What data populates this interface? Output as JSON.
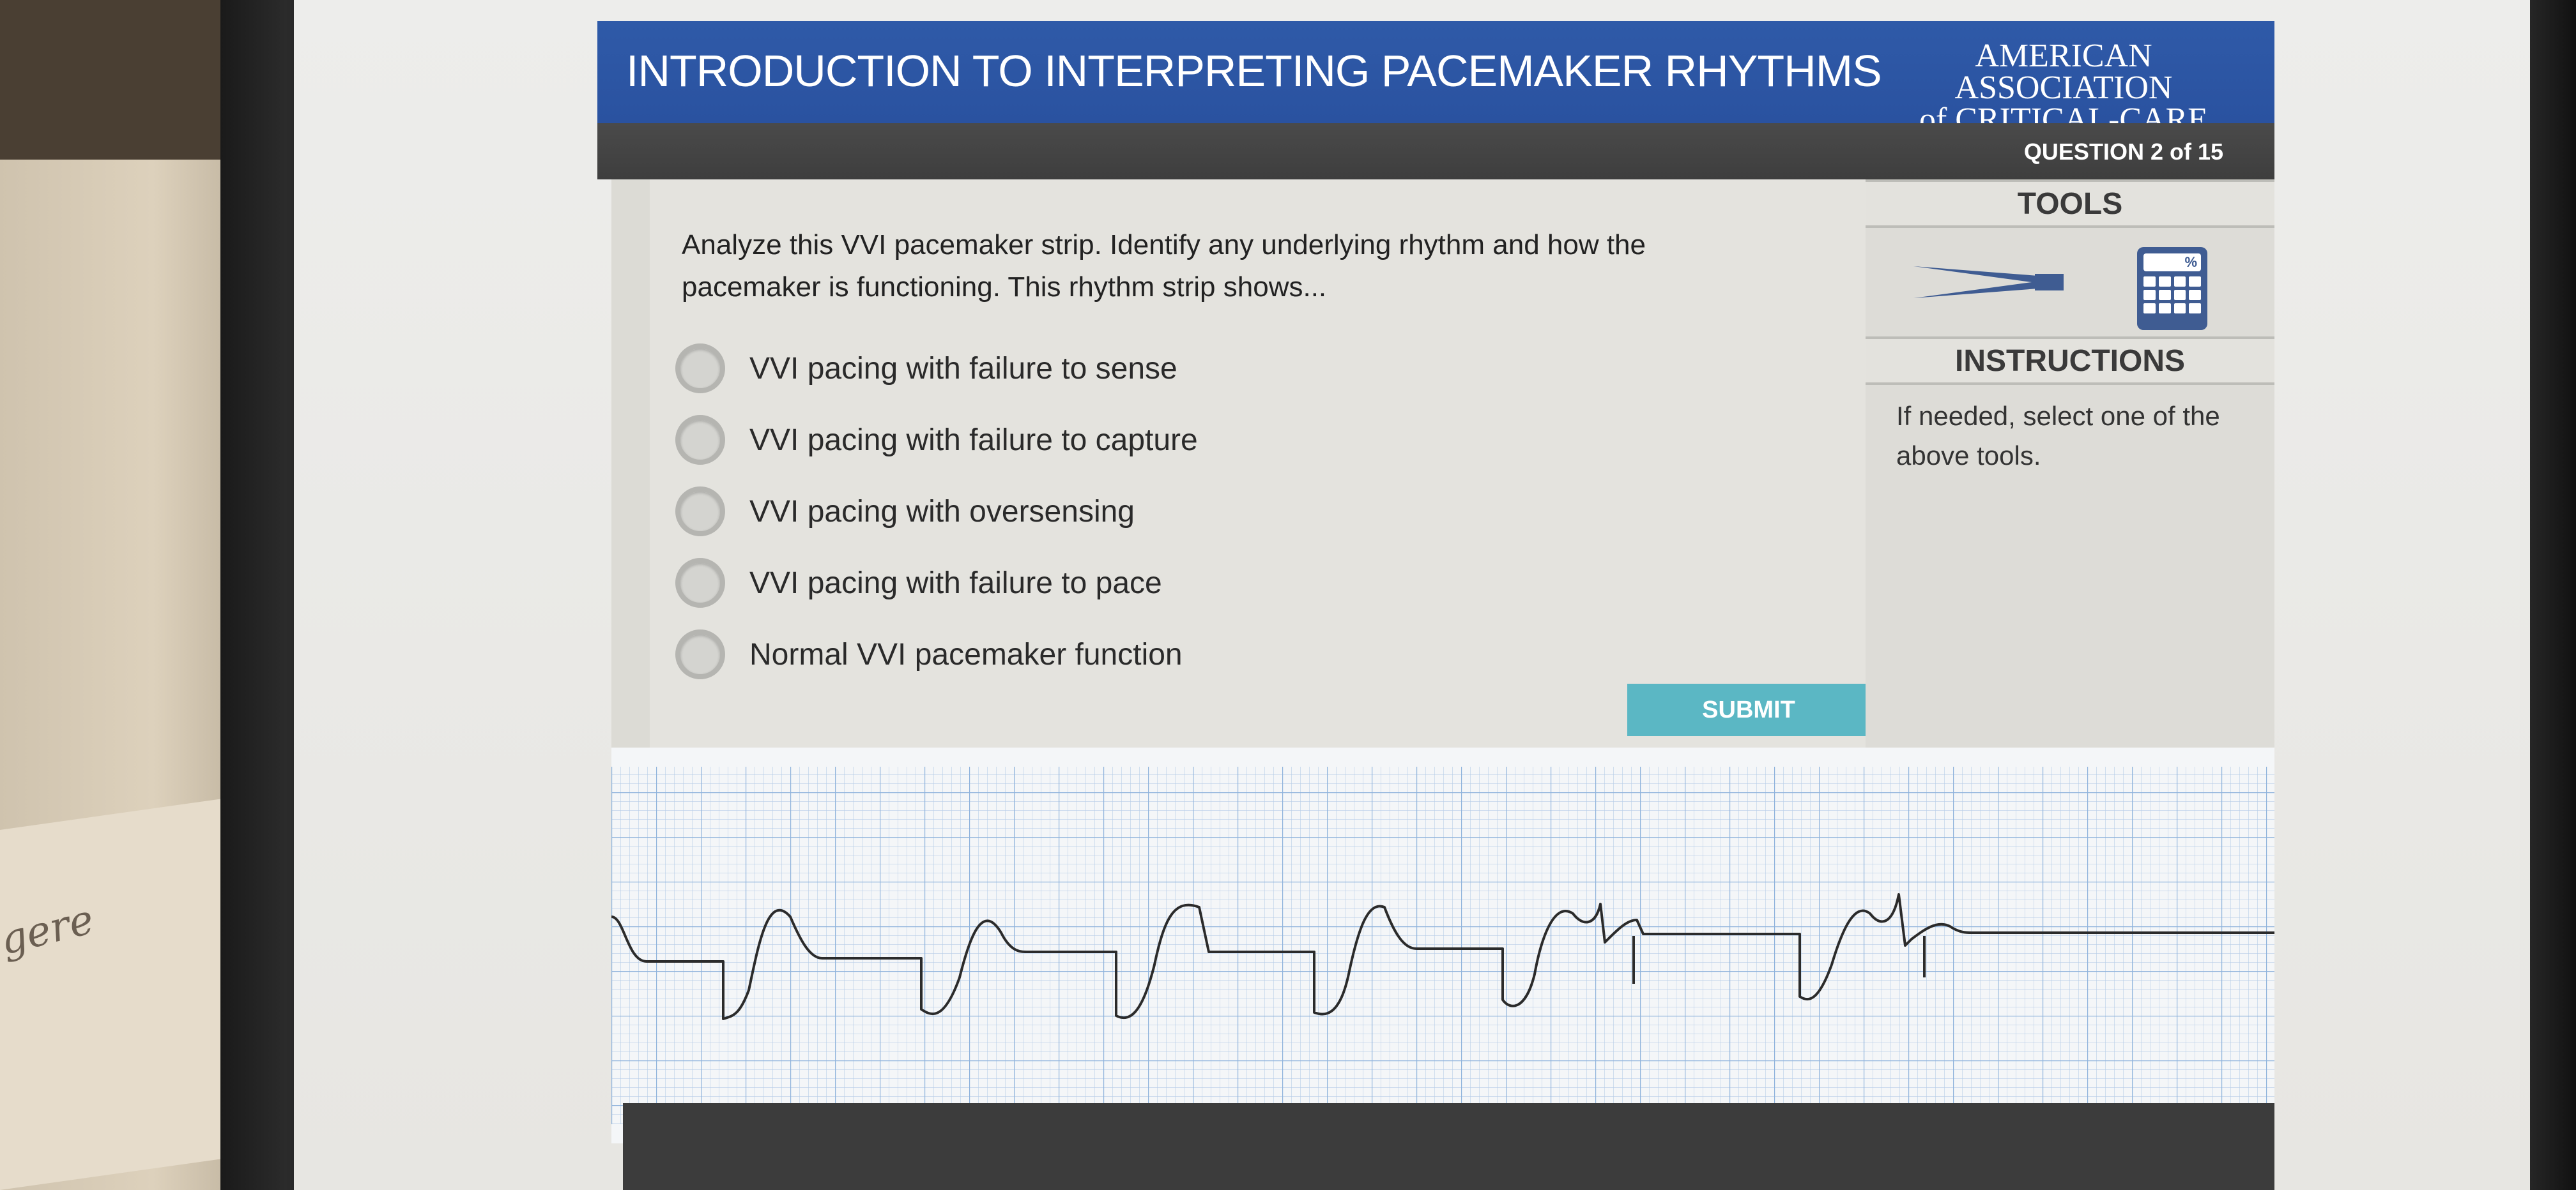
{
  "header": {
    "title": "INTRODUCTION TO INTERPRETING PACEMAKER RHYTHMS",
    "brand_line1": "AMERICAN ASSOCIATION",
    "brand_line2": "of CRITICAL-CARE NURSES"
  },
  "subbar": {
    "question_count": "QUESTION 2 of 15"
  },
  "question": {
    "prompt": "Analyze this VVI pacemaker strip. Identify any underlying rhythm and how the pacemaker is functioning.  This rhythm strip shows...",
    "options": [
      "VVI pacing with failure to sense",
      "VVI pacing with failure to capture",
      "VVI pacing with oversensing",
      "VVI pacing with failure to pace",
      "Normal VVI pacemaker function"
    ],
    "submit_label": "SUBMIT"
  },
  "side": {
    "tools_heading": "TOOLS",
    "instructions_heading": "INSTRUCTIONS",
    "instructions_text": "If needed, select one of the above tools.",
    "calc_symbol": "%"
  },
  "desk": {
    "scribble": "gere"
  },
  "colors": {
    "header_blue": "#2f5aa8",
    "subbar_gray": "#454545",
    "submit_teal": "#5bb7c4",
    "grid_blue": "#8fb3dc",
    "trace": "#2b2b2b"
  }
}
